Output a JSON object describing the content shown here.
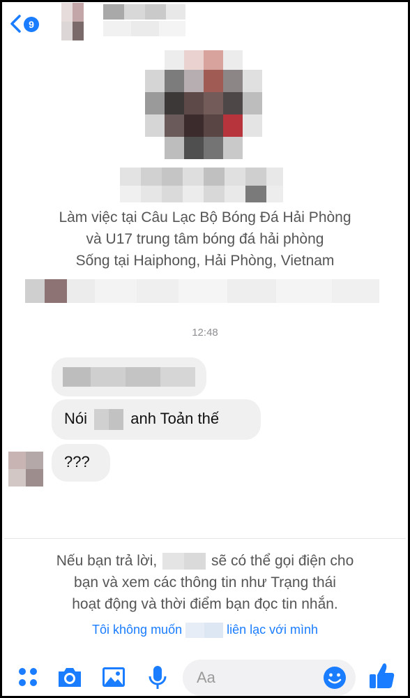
{
  "header": {
    "unread_count": "9",
    "back_icon": "chevron-left-icon"
  },
  "profile": {
    "info_line_1": "Làm việc tại Câu Lạc Bộ Bóng Đá Hải Phòng",
    "info_line_2": "và U17 trung tâm bóng đá hải phòng",
    "info_line_3": "Sống tại Haiphong, Hải Phòng, Vietnam"
  },
  "conversation": {
    "timestamp": "12:48",
    "messages": [
      {
        "text_before": "",
        "text_after": ""
      },
      {
        "text_before": "Nói",
        "text_after": "anh Toản thế"
      },
      {
        "text_before": "???",
        "text_after": ""
      }
    ]
  },
  "request_notice": {
    "line_1_before": "Nếu bạn trả lời,",
    "line_1_after": "sẽ có thể gọi điện cho",
    "line_2": "bạn và xem các thông tin như Trạng thái",
    "line_3": "hoạt động và thời điểm bạn đọc tin nhắn.",
    "decline_before": "Tôi không muốn",
    "decline_after": "liên lạc với mình"
  },
  "composer": {
    "placeholder": "Aa"
  },
  "colors": {
    "accent": "#1a7cff",
    "bubble": "#f0f0f0",
    "muted_text": "#555555"
  },
  "icons": [
    "apps-icon",
    "camera-icon",
    "image-icon",
    "microphone-icon",
    "emoji-icon",
    "thumbs-up-icon"
  ]
}
